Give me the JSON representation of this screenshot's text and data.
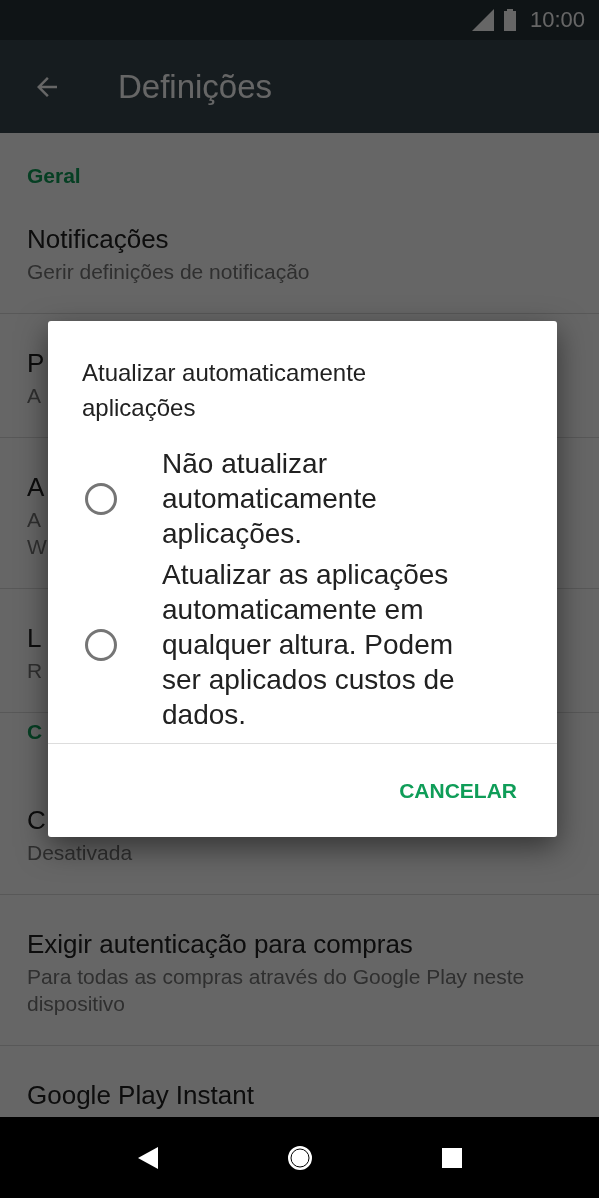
{
  "status_bar": {
    "time": "10:00"
  },
  "toolbar": {
    "title": "Definições"
  },
  "sections": [
    {
      "header": "Geral",
      "items": [
        {
          "title": "Notificações",
          "subtitle": [
            "Gerir definições de notificação"
          ]
        },
        {
          "title": "P",
          "subtitle": [
            "A"
          ]
        },
        {
          "title": "A",
          "subtitle": [
            "A",
            "W"
          ]
        },
        {
          "title": "L",
          "subtitle": [
            "R"
          ]
        }
      ]
    },
    {
      "header": "C",
      "items": [
        {
          "title": "C",
          "subtitle": [
            "Desativada"
          ]
        },
        {
          "title": "Exigir autenticação para compras",
          "subtitle": [
            "Para todas as compras através do Google Play neste dispositivo"
          ]
        },
        {
          "title": "Google Play Instant"
        }
      ]
    }
  ],
  "dialog": {
    "title": "Atualizar automaticamente aplicações",
    "options": [
      {
        "label": "Não atualizar automaticamente aplicações.",
        "selected": false
      },
      {
        "label": "Atualizar as aplicações automaticamente em qualquer altura. Podem ser aplicados custos de dados.",
        "selected": false
      }
    ],
    "button": "CANCELAR"
  }
}
